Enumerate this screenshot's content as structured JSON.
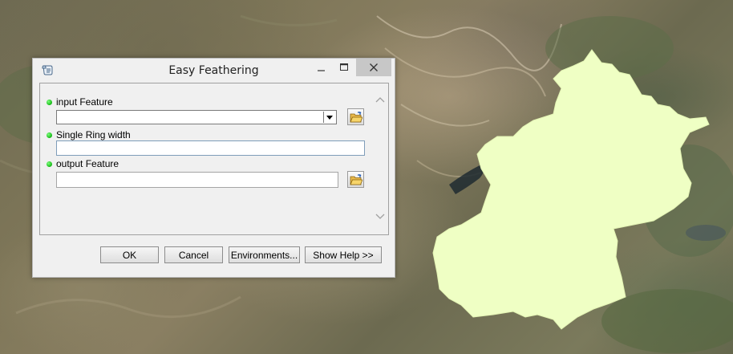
{
  "window": {
    "title": "Easy Feathering",
    "minimize_icon": "minimize-icon",
    "maximize_icon": "maximize-icon",
    "close_icon": "close-icon"
  },
  "parameters": [
    {
      "label": "input Feature",
      "value": "",
      "control": "dropdown"
    },
    {
      "label": "Single Ring width",
      "value": "",
      "control": "textbox"
    },
    {
      "label": "output Feature",
      "value": "",
      "control": "textbox"
    }
  ],
  "buttons": {
    "ok": "OK",
    "cancel": "Cancel",
    "environments": "Environments...",
    "show_help": "Show Help >>"
  },
  "colors": {
    "polygon_fill": "#efffc4",
    "required_dot": "#14b814",
    "close_button_bg": "#c7c7c7"
  }
}
